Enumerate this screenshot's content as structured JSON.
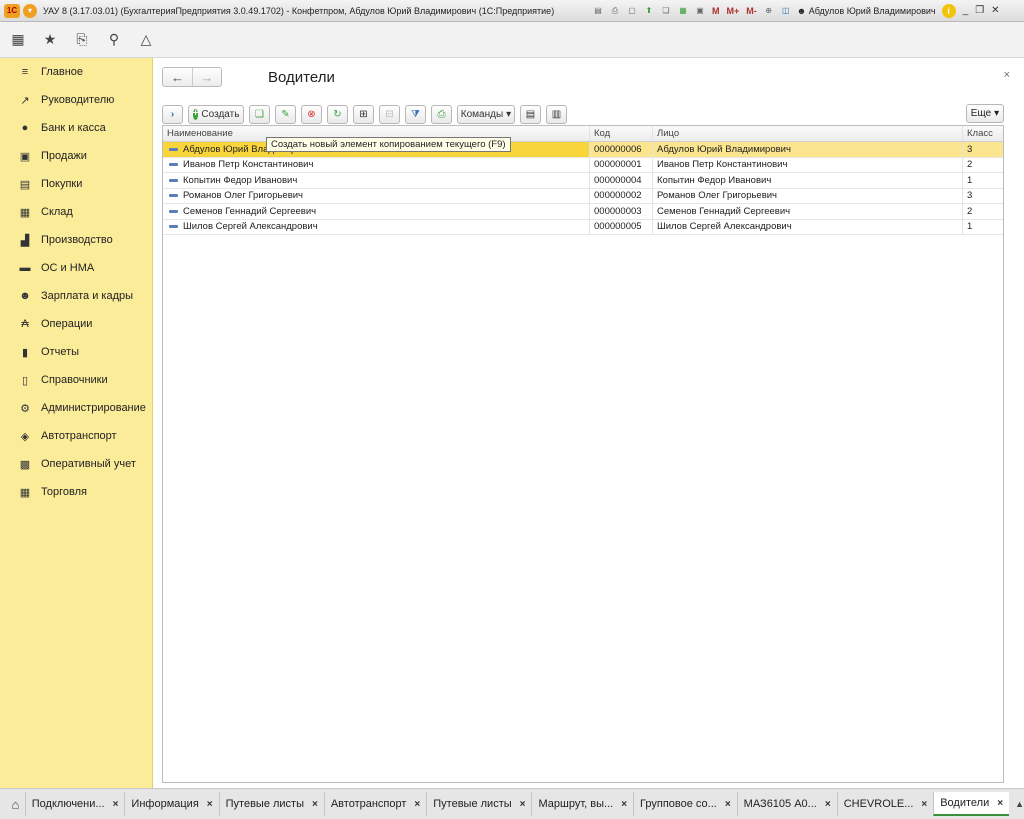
{
  "window": {
    "logo_text": "1С",
    "title": "УАУ 8 (3.17.03.01) (БухгалтерияПредприятия 3.0.49.1702) - Конфетпром, Абдулов Юрий Владимирович (1С:Предприятие)",
    "memory_buttons": [
      "M",
      "M+",
      "M-"
    ],
    "user": "Абдулов Юрий Владимирович",
    "info_glyph": "i",
    "controls": [
      "_",
      "❐",
      "✕"
    ]
  },
  "toolbar_icons": [
    "apps-grid-icon",
    "favorites-star-icon",
    "history-icon",
    "search-icon",
    "notifications-bell-icon"
  ],
  "sidebar": {
    "items": [
      {
        "label": "Главное",
        "icon": "≡"
      },
      {
        "label": "Руководителю",
        "icon": "↗"
      },
      {
        "label": "Банк и касса",
        "icon": "●"
      },
      {
        "label": "Продажи",
        "icon": "▣"
      },
      {
        "label": "Покупки",
        "icon": "▤"
      },
      {
        "label": "Склад",
        "icon": "▦"
      },
      {
        "label": "Производство",
        "icon": "▟"
      },
      {
        "label": "ОС и НМА",
        "icon": "▬"
      },
      {
        "label": "Зарплата и кадры",
        "icon": "☻"
      },
      {
        "label": "Операции",
        "icon": "₳"
      },
      {
        "label": "Отчеты",
        "icon": "▮"
      },
      {
        "label": "Справочники",
        "icon": "▯"
      },
      {
        "label": "Администрирование",
        "icon": "⚙"
      },
      {
        "label": "Автотранспорт",
        "icon": "◈"
      },
      {
        "label": "Оперативный учет",
        "icon": "▩"
      },
      {
        "label": "Торговля",
        "icon": "▦"
      }
    ]
  },
  "form": {
    "title": "Водители",
    "back_glyph": "←",
    "forward_glyph": "→",
    "close_glyph": "×",
    "create_label": "Создать",
    "commands_label": "Команды",
    "more_label": "Еще",
    "tooltip": "Создать новый элемент копированием текущего (F9)"
  },
  "table": {
    "columns": [
      "Наименование",
      "Код",
      "Лицо",
      "Класс"
    ],
    "rows": [
      {
        "name": "Абдулов Юрий Владимирович",
        "code": "000000006",
        "person": "Абдулов Юрий Владимирович",
        "class": "3"
      },
      {
        "name": "Иванов  Петр  Константинович",
        "code": "000000001",
        "person": "Иванов  Петр  Константинович",
        "class": "2"
      },
      {
        "name": "Копытин Федор Иванович",
        "code": "000000004",
        "person": "Копытин Федор Иванович",
        "class": "1"
      },
      {
        "name": "Романов Олег Григорьевич",
        "code": "000000002",
        "person": "Романов Олег Григорьевич",
        "class": "3"
      },
      {
        "name": "Семенов Геннадий Сергеевич",
        "code": "000000003",
        "person": "Семенов Геннадий Сергеевич",
        "class": "2"
      },
      {
        "name": "Шилов Сергей Александрович",
        "code": "000000005",
        "person": "Шилов Сергей Александрович",
        "class": "1"
      }
    ]
  },
  "tabs": [
    {
      "label": "Подключени...",
      "active": false
    },
    {
      "label": "Информация",
      "active": false
    },
    {
      "label": "Путевые листы",
      "active": false
    },
    {
      "label": "Автотранспорт",
      "active": false
    },
    {
      "label": "Путевые листы",
      "active": false
    },
    {
      "label": "Маршрут, вы...",
      "active": false
    },
    {
      "label": "Групповое со...",
      "active": false
    },
    {
      "label": "МАЗ6105 А0...",
      "active": false
    },
    {
      "label": "CHEVROLE...",
      "active": false
    },
    {
      "label": "Водители",
      "active": true
    }
  ],
  "colors": {
    "sidebar": "#fbec9a",
    "selected_row": "#fbe58f",
    "selected_cell": "#f8d53a",
    "create_accent": "#3c9f3c",
    "delete_accent": "#d93030"
  }
}
